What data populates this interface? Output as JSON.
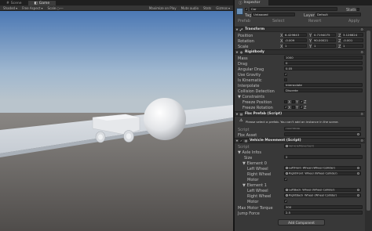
{
  "scene": {
    "tabs": [
      {
        "label": "Scene",
        "icon": "scene-icon"
      },
      {
        "label": "Game",
        "icon": "game-icon"
      }
    ],
    "toolbar": {
      "shading": "Shaded",
      "mode": "2D",
      "aspect": "Free Aspect",
      "scale_label": "Scale",
      "maximize": "Maximize on Play",
      "mute": "Mute audio",
      "stats": "Stats",
      "gizmos": "Gizmos"
    }
  },
  "inspector": {
    "tab_label": "Inspector",
    "object": {
      "active": true,
      "name": "Car",
      "static_label": "Static",
      "tag_label": "Tag",
      "tag_value": "Untagged",
      "layer_label": "Layer",
      "layer_value": "Default",
      "prefab_label": "Prefab",
      "prefab_select": "Select",
      "prefab_revert": "Revert",
      "prefab_apply": "Apply"
    },
    "transform": {
      "title": "Transform",
      "position_label": "Position",
      "position": {
        "x": "6.429643",
        "y": "0.7194075",
        "z": "3.126624"
      },
      "rotation_label": "Rotation",
      "rotation": {
        "x": "-0.009",
        "y": "90.00021",
        "z": "-0.001"
      },
      "scale_label": "Scale",
      "scale": {
        "x": "1",
        "y": "1",
        "z": "1"
      }
    },
    "rigidbody": {
      "title": "Rigidbody",
      "mass_label": "Mass",
      "mass": "1000",
      "drag_label": "Drag",
      "drag": "0",
      "angular_drag_label": "Angular Drag",
      "angular_drag": "0.05",
      "use_gravity_label": "Use Gravity",
      "use_gravity": true,
      "is_kinematic_label": "Is Kinematic",
      "is_kinematic": false,
      "interpolate_label": "Interpolate",
      "interpolate": "Interpolate",
      "collision_label": "Collision Detection",
      "collision": "Discrete",
      "constraints_label": "Constraints",
      "freeze_pos_label": "Freeze Position",
      "freeze_rot_label": "Freeze Rotation",
      "axis_x": "X",
      "axis_y": "Y",
      "axis_z": "Z"
    },
    "fbx_prefab": {
      "title": "Fbx Prefab (Script)",
      "message": "Please select a prefab. You can't add an instance in the scene.",
      "script_label": "Script",
      "script": "FbxPrefab",
      "fbx_asset_label": "Fbx Asset"
    },
    "vehicle": {
      "title": "Vehicle Movement (Script)",
      "script_label": "Script",
      "script": "VehicleMovement",
      "axle_info_label": "Axle Infos",
      "size_label": "Size",
      "size": "2",
      "elements": [
        {
          "label": "Element 0",
          "left_wheel_label": "Left Wheel",
          "left_wheel": "LeftFront_Wheel (Wheel Collider)",
          "right_wheel_label": "Right Wheel",
          "right_wheel": "RightFront_Wheel (Wheel Collider)",
          "motor_label": "Motor",
          "motor": true
        },
        {
          "label": "Element 1",
          "left_wheel_label": "Left Wheel",
          "left_wheel": "LeftBack_Wheel (Wheel Collider)",
          "right_wheel_label": "Right Wheel",
          "right_wheel": "RightBack_Wheel (Wheel Collider)",
          "motor_label": "Motor",
          "motor": true
        }
      ],
      "max_torque_label": "Max Motor Torque",
      "max_torque": "200",
      "jump_force_label": "Jump Force",
      "jump_force": "2.5"
    },
    "add_component": "Add Component"
  },
  "colors": {
    "panel_bg": "#383838",
    "header_bg": "#2f2f2f",
    "sky_top": "#5a86c0",
    "ground": "#6a6662"
  }
}
